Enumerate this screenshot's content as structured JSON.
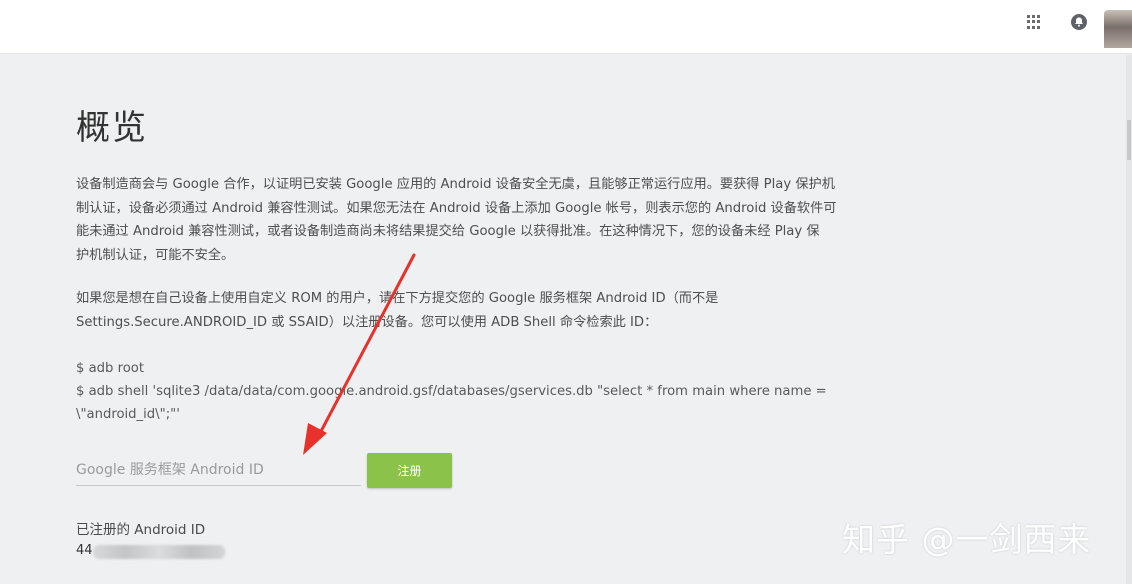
{
  "header": {
    "apps_icon": "apps-grid-icon",
    "notification_icon": "notification-bell-icon"
  },
  "main": {
    "title": "概览",
    "paragraph1": "设备制造商会与 Google 合作，以证明已安装 Google 应用的 Android 设备安全无虞，且能够正常运行应用。要获得 Play 保护机\n制认证，设备必须通过 Android 兼容性测试。如果您无法在 Android 设备上添加 Google 帐号，则表示您的 Android 设备软件可\n能未通过 Android 兼容性测试，或者设备制造商尚未将结果提交给 Google 以获得批准。在这种情况下，您的设备未经 Play 保\n护机制认证，可能不安全。",
    "paragraph2": "如果您是想在自己设备上使用自定义 ROM 的用户，请在下方提交您的 Google 服务框架 Android ID（而不是\nSettings.Secure.ANDROID_ID 或 SSAID）以注册设备。您可以使用 ADB Shell 命令检索此 ID：",
    "code": "$ adb root\n$ adb shell 'sqlite3 /data/data/com.google.android.gsf/databases/gservices.db \"select * from main where name =\n\\\"android_id\\\";\"'",
    "input_placeholder": "Google 服务框架 Android ID",
    "input_value": "",
    "register_label": "注册",
    "registered_label": "已注册的 Android ID",
    "registered_value": "44"
  },
  "watermark": "知乎 @一剑西来",
  "colors": {
    "accent_button": "#8bc34a",
    "arrow": "#e8312a",
    "background": "#eef0f1"
  }
}
